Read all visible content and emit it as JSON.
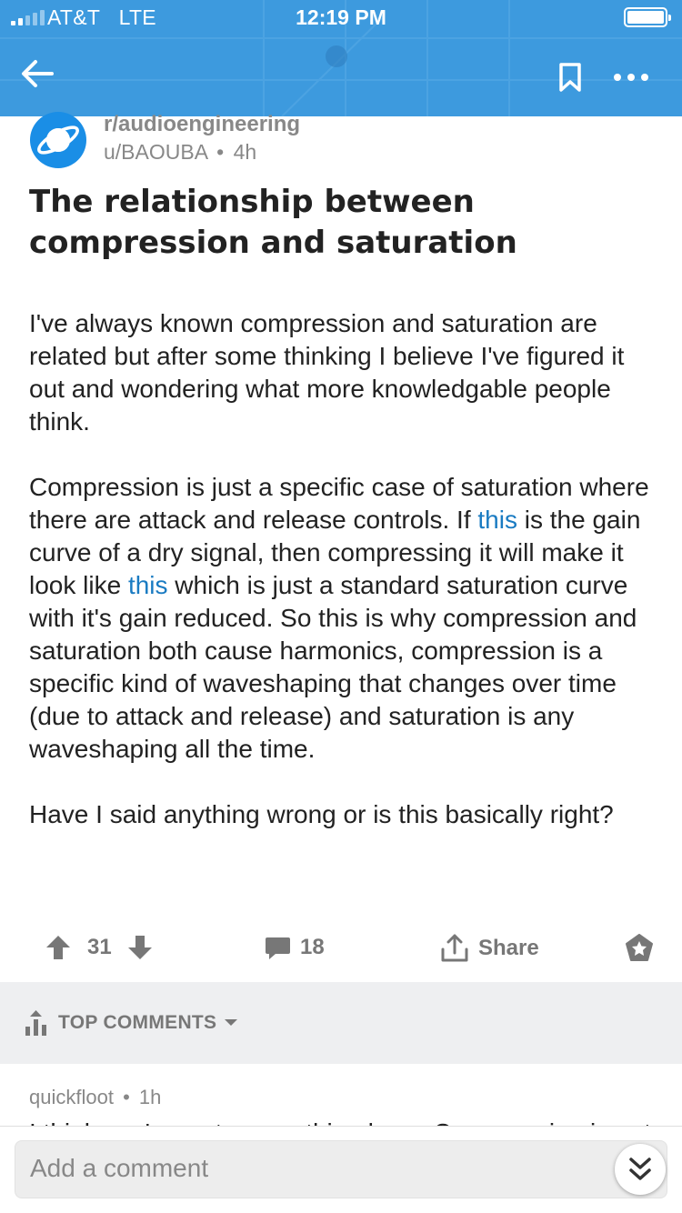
{
  "status_bar": {
    "carrier": "AT&T",
    "network": "LTE",
    "time": "12:19 PM",
    "battery_level": 1.0
  },
  "header": {
    "background_color": "#3d9ade",
    "back_icon": "back-arrow-icon",
    "bookmark_icon": "bookmark-icon",
    "more_icon": "more-dots-icon"
  },
  "post": {
    "subreddit": "r/audioengineering",
    "author": "u/BAOUBA",
    "age": "4h",
    "title": "The relationship between compression and saturation",
    "paragraph1": "I've always known compression and saturation are related but after some thinking I believe I've figured it out and wondering what more knowledgable people think.",
    "p2_part1": "Compression is just a specific case of saturation where there are attack and release controls. If ",
    "p2_link1": "this",
    "p2_part2": " is the gain curve of a dry signal, then compressing it will make it look like ",
    "p2_link2": "this",
    "p2_part3": " which is just a standard saturation curve with it's gain reduced. So this is why compression and saturation both cause harmonics, compression is a specific kind of waveshaping that changes over time (due to attack and release) and saturation is any waveshaping all the time.",
    "paragraph3": "Have I said anything wrong or is this basically right?",
    "link_color": "#1a7bc2"
  },
  "actions": {
    "score": "31",
    "comment_count": "18",
    "share_label": "Share"
  },
  "comments": {
    "sort_label": "TOP COMMENTS",
    "first_author": "quickfloot",
    "first_age": "1h",
    "first_snippet": "I think you're on to something here. Compression is not"
  },
  "composer": {
    "placeholder": "Add a comment"
  }
}
